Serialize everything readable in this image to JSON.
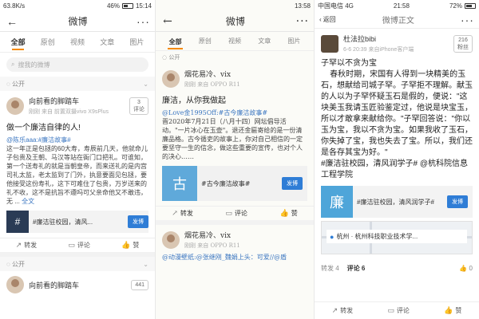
{
  "panel1": {
    "status": {
      "time": "15:14",
      "net": "63.8K/s",
      "battery": "46%",
      "batt_fill": 0.46
    },
    "nav": {
      "title": "微博"
    },
    "tabs": [
      "全部",
      "原创",
      "视频",
      "文章",
      "图片"
    ],
    "search_placeholder": "搜我的微博",
    "section": "公开",
    "post1": {
      "user": "向前看的脚踏车",
      "meta": "刚刚  来自 前置双摄vivo X9sPlus",
      "badge_num": "3",
      "badge_label": "评论",
      "title": "做一个廉洁自律的人!",
      "topic": "@陈乐aaa:#廉洁故事#",
      "body": "这一年正是包拯的60大寿，寿辰前几天，他就命儿子包贵及王朝、马汉等站在衙门口把礼。可谁知，第一个送寿礼的就是当朝皇帝，而来送礼的是内宫司礼太监，老太监到了门外，执意要面见包拯，要他接受这份寿礼，这下可难住了包贵，万岁送来的礼不收，这不是抗旨不遵吗可父亲命他又不敢违，无 ...",
      "more": "全文",
      "card_text": "#廉洁驻校园，清风...",
      "card_btn": "发博"
    },
    "actions": {
      "repost": "转发",
      "comment": "评论",
      "like": "赞"
    },
    "post2": {
      "user": "向前看的脚踏车",
      "badge_num": "441"
    }
  },
  "panel2": {
    "status": {
      "time": "13:58"
    },
    "nav": {
      "title": "微博"
    },
    "tabs": [
      "全部",
      "原创",
      "视频",
      "文章",
      "图片"
    ],
    "section": "公开",
    "post": {
      "user": "烟花易冷、vix",
      "meta": "刚刚 来自 OPPO R11",
      "title": "廉洁，从你我做起",
      "topic": "@Love金1995Off:#古今廉洁故事#",
      "body": "晋2020年7月21日（八月十四）网坛倡导活动。\"一片冰心在玉壶\"。退还金匾寄给的是一份清廉品格。古今循吏的故事上，你对自己相信的一定要坚守一生的信念，做这些重要的宣传，也对个人的决心……",
      "card_text": "#古今廉洁故事#",
      "card_btn": "发博",
      "thumb": "古"
    },
    "actions": {
      "repost": "转发",
      "comment": "评论",
      "like": "赞"
    },
    "post2": {
      "user": "烟花易冷、vix",
      "meta": "刚刚 来自 OPPO R11",
      "topic": "@动漫壁纸:@张继刚_魏娟上头：可爱//@盾"
    }
  },
  "panel3": {
    "status": {
      "carrier": "中国电信",
      "net": "4G",
      "time": "21:58",
      "battery": "72%",
      "batt_fill": 0.72
    },
    "nav": {
      "back": "返回",
      "title": "微博正文"
    },
    "post": {
      "user": "杜法拉bibi",
      "meta": "6-6 20:39  来自iPhone客户端",
      "badge_num": "216",
      "badge_label": "粉丝",
      "body": "子罕以不贪为宝\n    春秋时期，宋国有人得到一块精美的玉石，想献给司城子罕。子罕拒不理解。献玉的人以为子罕怀疑玉石是假的，便说：\"这块美玉我请玉匠验鉴定过，他说是块宝玉，所以才敢拿来献给你。\"子罕回答说：\"你以玉为宝，我以不贪为宝。如果我收了玉石，你失掉了宝，我也失去了宝。所以，我们还是各存其宝为好。\"",
      "topics": "#廉洁驻校园，清风润学子# @杭科院信息工程学院",
      "card_text": "#廉洁驻校园，清风润学子#",
      "card_btn": "发博",
      "thumb": "廉",
      "location": "杭州 · 杭州科技职业技术学..."
    },
    "stats": {
      "repost": "转发 4",
      "comment": "评论 6",
      "like": "0"
    },
    "tabbar": {
      "repost": "转发",
      "comment": "评论",
      "like": "赞"
    }
  }
}
